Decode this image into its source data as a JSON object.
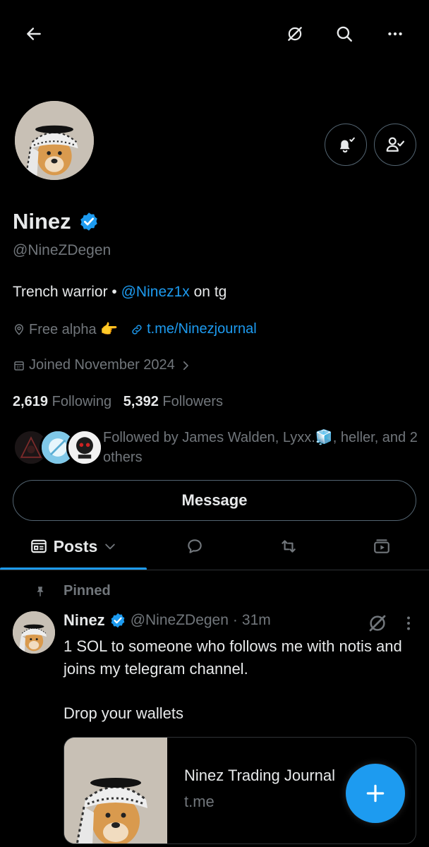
{
  "profile": {
    "name": "Ninez",
    "handle": "@NineZDegen",
    "bio_text": "Trench warrior • ",
    "bio_link": "@Ninez1x",
    "bio_suffix": " on tg",
    "location": "Free alpha 👉",
    "website": "t.me/Ninezjournal",
    "joined": "Joined November 2024",
    "following_count": "2,619",
    "following_label": "Following",
    "followers_count": "5,392",
    "followers_label": "Followers",
    "followed_by": "Followed by James Walden, Lyxx.🧊, heller, and 2 others",
    "message_label": "Message"
  },
  "tabs": {
    "posts_label": "Posts"
  },
  "post": {
    "pinned_label": "Pinned",
    "author_name": "Ninez",
    "author_handle": "@NineZDegen",
    "separator": "·",
    "time": "31m",
    "paragraph1": "1 SOL to someone who follows me with notis and joins my telegram channel.",
    "paragraph2": "Drop your wallets",
    "card_title": "Ninez Trading Journal",
    "card_domain": "t.me"
  },
  "colors": {
    "accent": "#1d9bf0",
    "background": "#000000",
    "text": "#e7e9ea",
    "muted": "#71767b",
    "border": "#2f3336"
  },
  "icons": [
    "back-arrow-icon",
    "grok-icon",
    "search-icon",
    "more-icon",
    "bell-subscribed-icon",
    "following-user-icon",
    "verified-icon",
    "location-icon",
    "link-icon",
    "calendar-icon",
    "chevron-right-icon",
    "posts-icon",
    "chevron-down-icon",
    "reply-icon",
    "repost-icon",
    "media-icon",
    "pin-icon",
    "plus-icon"
  ]
}
